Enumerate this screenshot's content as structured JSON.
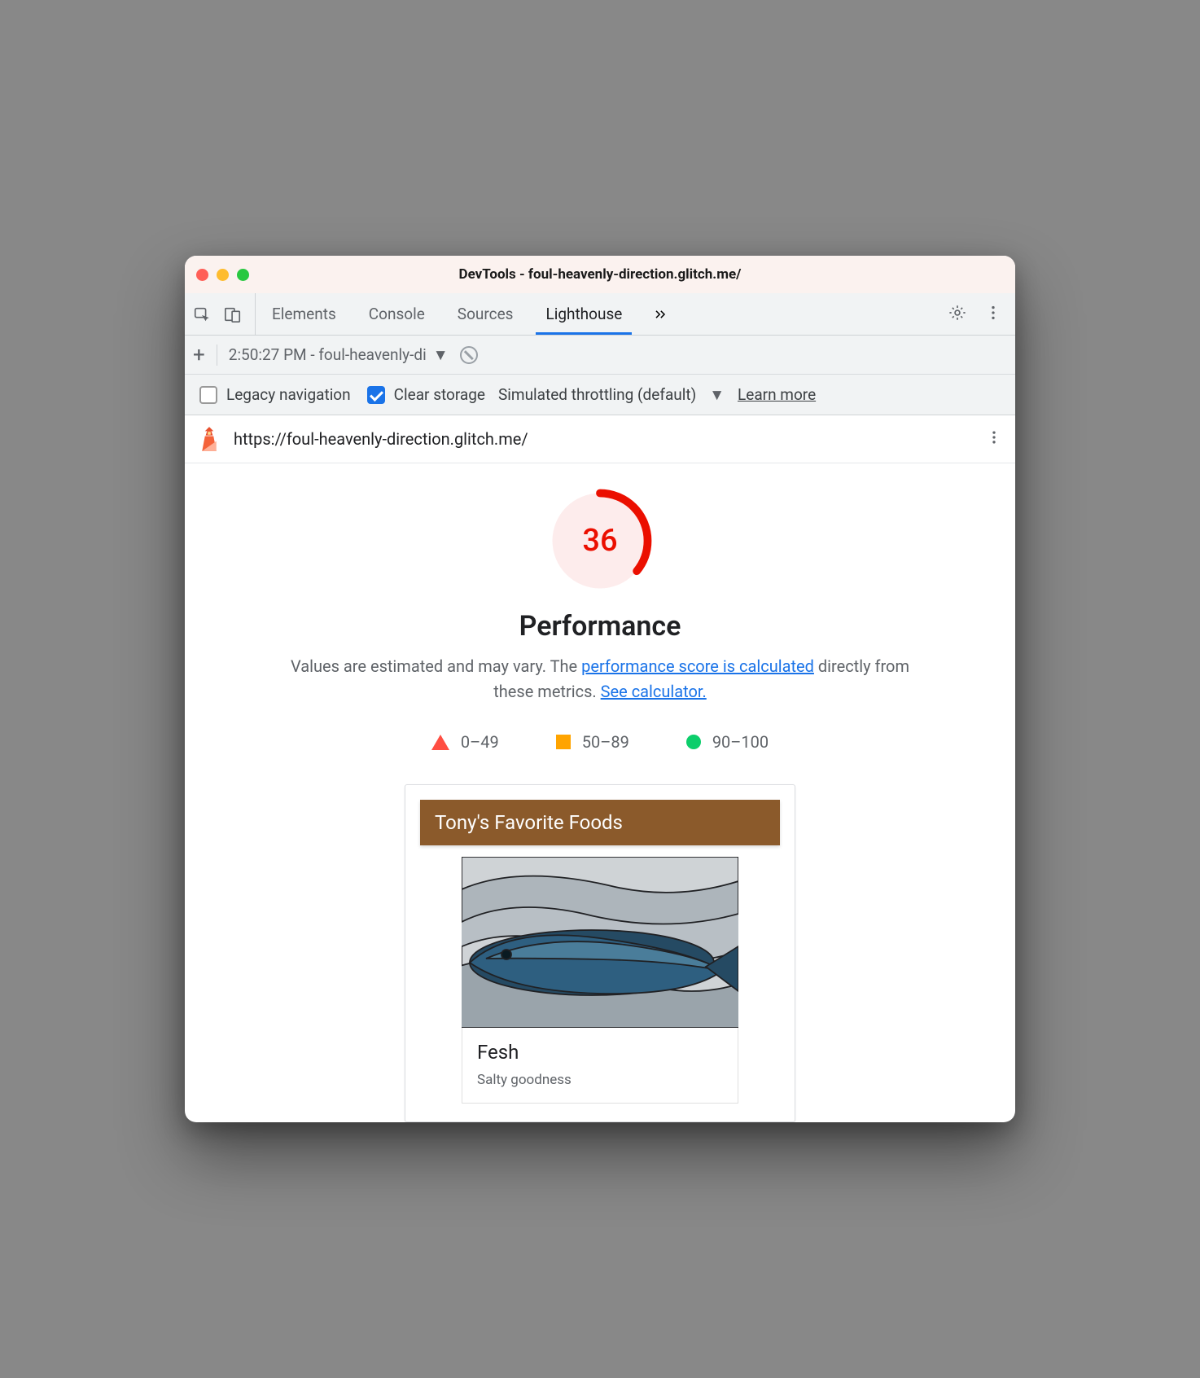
{
  "window": {
    "title": "DevTools - foul-heavenly-direction.glitch.me/"
  },
  "tabs": {
    "elements": "Elements",
    "console": "Console",
    "sources": "Sources",
    "lighthouse": "Lighthouse"
  },
  "subbar": {
    "reportLabel": "2:50:27 PM - foul-heavenly-di"
  },
  "options": {
    "legacyLabel": "Legacy navigation",
    "legacyChecked": false,
    "clearLabel": "Clear storage",
    "clearChecked": true,
    "throttleLabel": "Simulated throttling (default)",
    "learnMore": "Learn more"
  },
  "report": {
    "url": "https://foul-heavenly-direction.glitch.me/",
    "score": "36",
    "category": "Performance",
    "descPrefix": "Values are estimated and may vary. The ",
    "link1": "performance score is calculated",
    "descMiddle": " directly from these metrics. ",
    "link2": "See calculator.",
    "legend": {
      "low": "0–49",
      "mid": "50–89",
      "high": "90–100"
    },
    "colors": {
      "low": "#ff4e42",
      "mid": "#ffa400",
      "high": "#0cce6b",
      "accent": "#1a73e8",
      "scoreRing": "#eb0f00"
    }
  },
  "preview": {
    "header": "Tony's Favorite Foods",
    "itemTitle": "Fesh",
    "itemSubtitle": "Salty goodness"
  }
}
